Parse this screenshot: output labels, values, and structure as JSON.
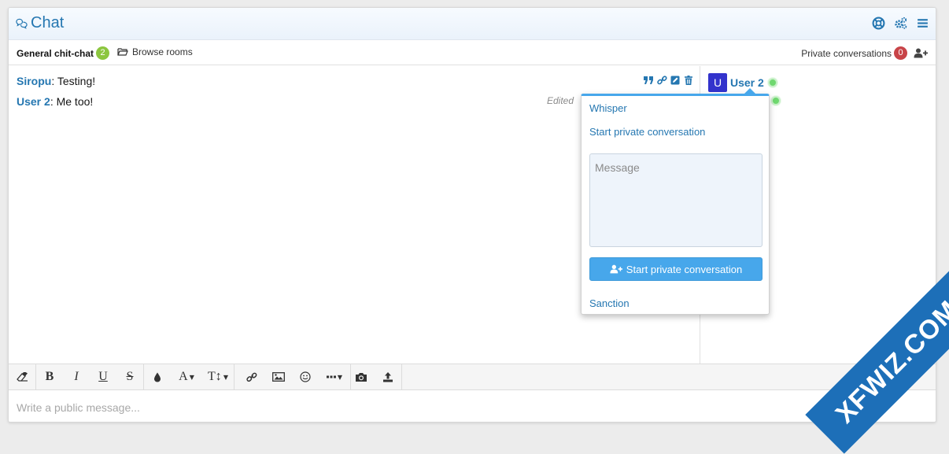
{
  "header": {
    "title": "Chat",
    "icons": [
      "chat-bubbles-icon",
      "life-ring-icon",
      "cogs-icon",
      "bars-icon"
    ]
  },
  "tabs": {
    "room_name": "General chit-chat",
    "room_count": "2",
    "browse_label": "Browse rooms",
    "private_label": "Private conversations",
    "private_count": "0"
  },
  "messages": [
    {
      "author": "Siropu",
      "text": ": Testing!"
    },
    {
      "author": "User 2",
      "text": ": Me too!",
      "edited_label": "Edited"
    }
  ],
  "message_actions": [
    "quote-icon",
    "link-icon",
    "edit-icon",
    "trash-icon"
  ],
  "userlist": {
    "users": [
      {
        "avatar_letter": "U",
        "name": "User 2",
        "status": "online"
      }
    ]
  },
  "popup": {
    "whisper_label": "Whisper",
    "start_private_label": "Start private conversation",
    "message_placeholder": "Message",
    "submit_label": "Start private conversation",
    "sanction_label": "Sanction"
  },
  "composer": {
    "placeholder": "Write a public message..."
  },
  "toolbar": {
    "bold": "B",
    "italic": "I",
    "underline": "U",
    "strike": "S",
    "font_family": "A",
    "font_size": "T↕"
  },
  "watermark": "XFWIZ.COM",
  "colors": {
    "accent": "#2577b1",
    "button": "#47a7eb",
    "badge_green": "#8cc63f",
    "badge_red": "#c84448",
    "avatar": "#3333cc",
    "online": "#6fd86f"
  }
}
